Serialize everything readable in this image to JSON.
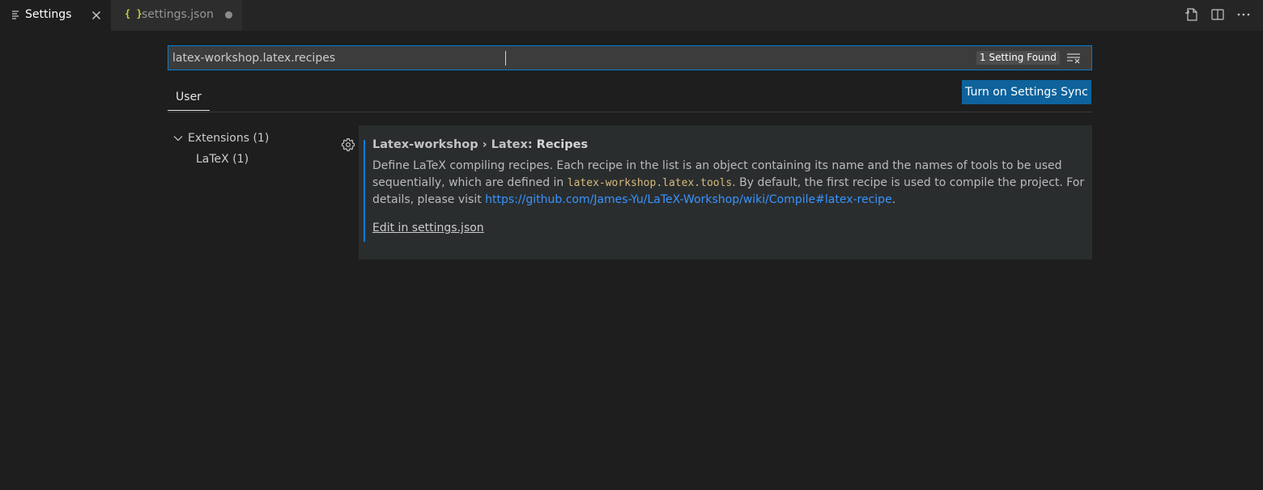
{
  "tabs": [
    {
      "label": "Settings",
      "icon": "settings-editor-icon",
      "active": true,
      "close": "close-icon"
    },
    {
      "label": "settings.json",
      "icon": "json-braces-icon",
      "braces": "{ }",
      "active": false,
      "dirty": true
    }
  ],
  "editor_actions": [
    "open-settings-json-icon",
    "split-editor-icon",
    "more-actions-icon"
  ],
  "search": {
    "value": "latex-workshop.latex.recipes",
    "result_count": "1 Setting Found",
    "clear_icon": "clear-filter-icon"
  },
  "scope": {
    "tabs": [
      {
        "label": "User",
        "active": true
      }
    ]
  },
  "sync_button": {
    "label": "Turn on Settings Sync"
  },
  "toc": [
    {
      "label": "Extensions (1)",
      "expanded": true,
      "icon": "chevron-down-icon"
    },
    {
      "label": "LaTeX (1)"
    }
  ],
  "setting": {
    "gear_icon": "gear-icon",
    "category": "Latex-workshop › Latex: ",
    "name": "Recipes",
    "description_part1": "Define LaTeX compiling recipes. Each recipe in the list is an object containing its name and the names of tools to be used sequentially, which are defined in ",
    "description_code": "latex-workshop.latex.tools",
    "description_part2": ". By default, the first recipe is used to compile the project. For details, please visit ",
    "description_link": "https://github.com/James-Yu/LaTeX-Workshop/wiki/Compile#latex-recipe",
    "description_end": ".",
    "edit_link": "Edit in settings.json"
  },
  "colors": {
    "background": "#1e1e1e",
    "tab_bar": "#252526",
    "accent_border": "#007fd4",
    "button": "#0e639c",
    "link": "#3794ff",
    "code": "#d7ba7d",
    "json_icon": "#cbcb41",
    "modified_bar": "#0c7dd2"
  }
}
